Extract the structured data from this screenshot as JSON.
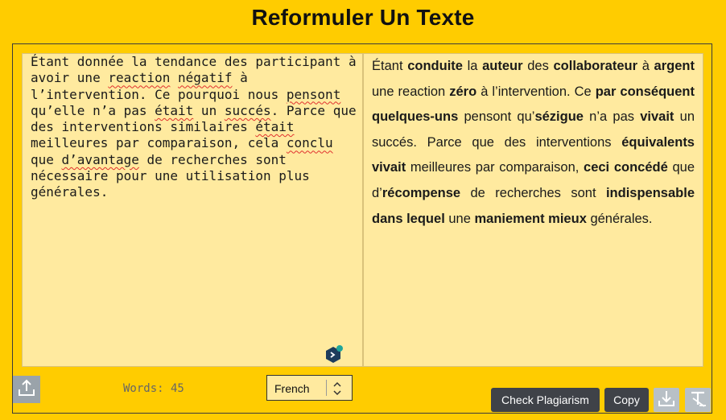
{
  "header": {
    "title": "Reformuler Un Texte"
  },
  "input": {
    "segments": [
      {
        "text": "Étant donnée la tendance des participant à avoir une ",
        "spell": false
      },
      {
        "text": "reaction",
        "spell": true
      },
      {
        "text": " ",
        "spell": false
      },
      {
        "text": "négatif",
        "spell": true
      },
      {
        "text": " à l’intervention. Ce pourquoi nous ",
        "spell": false
      },
      {
        "text": "pensont",
        "spell": true
      },
      {
        "text": " qu’elle n’a pas ",
        "spell": false
      },
      {
        "text": "était",
        "spell": true
      },
      {
        "text": " un ",
        "spell": false
      },
      {
        "text": "succés",
        "spell": true
      },
      {
        "text": ". Parce que des interventions similaires ",
        "spell": false
      },
      {
        "text": "était",
        "spell": true
      },
      {
        "text": " meilleures par comparaison, cela ",
        "spell": false
      },
      {
        "text": "conclu",
        "spell": true
      },
      {
        "text": " que ",
        "spell": false
      },
      {
        "text": "d’avantage",
        "spell": true
      },
      {
        "text": " de recherches sont nécessaire pour une utilisation plus générales.",
        "spell": false
      }
    ]
  },
  "output": {
    "segments": [
      {
        "text": "Étant ",
        "bold": false
      },
      {
        "text": "conduite",
        "bold": true
      },
      {
        "text": " la ",
        "bold": false
      },
      {
        "text": "auteur",
        "bold": true
      },
      {
        "text": " des ",
        "bold": false
      },
      {
        "text": "collaborateur",
        "bold": true
      },
      {
        "text": " à ",
        "bold": false
      },
      {
        "text": "argent",
        "bold": true
      },
      {
        "text": " une reaction ",
        "bold": false
      },
      {
        "text": "zéro",
        "bold": true
      },
      {
        "text": " à l’intervention. Ce ",
        "bold": false
      },
      {
        "text": "par conséquent quelques-uns",
        "bold": true
      },
      {
        "text": " pensont qu’",
        "bold": false
      },
      {
        "text": "sézigue",
        "bold": true
      },
      {
        "text": " n’a pas ",
        "bold": false
      },
      {
        "text": "vivait",
        "bold": true
      },
      {
        "text": " un succés. Parce que des interventions ",
        "bold": false
      },
      {
        "text": "équivalents vivait",
        "bold": true
      },
      {
        "text": " meilleures par comparaison, ",
        "bold": false
      },
      {
        "text": "ceci concédé",
        "bold": true
      },
      {
        "text": " que d’",
        "bold": false
      },
      {
        "text": "récompense",
        "bold": true
      },
      {
        "text": " de recherches sont ",
        "bold": false
      },
      {
        "text": "indispensable dans lequel",
        "bold": true
      },
      {
        "text": " une ",
        "bold": false
      },
      {
        "text": "maniement mieux",
        "bold": true
      },
      {
        "text": " générales.",
        "bold": false
      }
    ]
  },
  "footer": {
    "word_count": "Words: 45",
    "language": "French",
    "check_plagiarism_label": "Check Plagiarism",
    "copy_label": "Copy"
  },
  "icons": {
    "upload": "upload-icon",
    "download": "download-icon",
    "clear_format": "clear-format-icon",
    "grammar_assistant": "grammar-assistant-icon",
    "language_chevrons": "chevron-updown-icon"
  },
  "colors": {
    "background": "#ffcc00",
    "panel": "#ffea9f",
    "button_dark": "#3f4248",
    "icon_button": "#b8c0c6",
    "upload_button": "#9aa3aa",
    "spellcheck_underline": "#e0302e"
  }
}
